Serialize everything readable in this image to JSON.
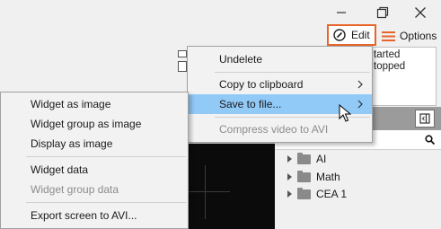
{
  "window": {
    "icons": [
      "restore-icon",
      "maximize-icon",
      "close-icon"
    ]
  },
  "toolbar": {
    "edit_label": "Edit",
    "options_label": "Options"
  },
  "log": {
    "lines": [
      "tarted",
      "topped"
    ]
  },
  "tree": {
    "search_placeholder": "Search",
    "items": [
      {
        "label": "AI"
      },
      {
        "label": "Math"
      },
      {
        "label": "CEA 1"
      }
    ]
  },
  "main_menu": {
    "items": [
      {
        "label": "Undelete",
        "disabled": false,
        "submenu": false
      },
      {
        "label": "Copy to clipboard",
        "disabled": false,
        "submenu": true
      },
      {
        "label": "Save to file...",
        "disabled": false,
        "submenu": true,
        "hovered": true
      },
      {
        "label": "Compress video to AVI",
        "disabled": true,
        "submenu": false
      }
    ]
  },
  "sub_menu": {
    "items": [
      {
        "label": "Widget as image",
        "disabled": false
      },
      {
        "label": "Widget group as image",
        "disabled": false
      },
      {
        "label": "Display as image",
        "disabled": false
      },
      {
        "label": "Widget data",
        "disabled": false
      },
      {
        "label": "Widget group data",
        "disabled": true
      },
      {
        "label": "Export screen to AVI...",
        "disabled": false
      }
    ]
  },
  "colors": {
    "accent": "#e8652a",
    "hover": "#91c9f7",
    "canvas": "#0b0b0b"
  }
}
